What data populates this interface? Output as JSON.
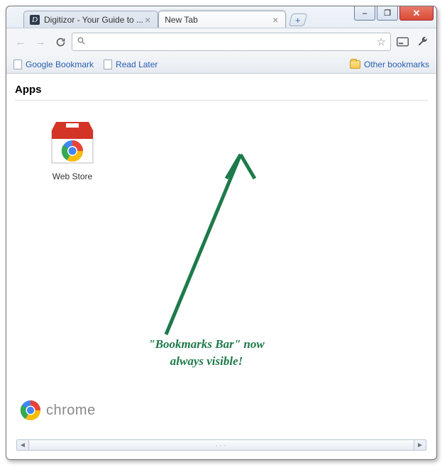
{
  "window_controls": {
    "minimize": "–",
    "maximize": "❐",
    "close": "✕"
  },
  "tabs": [
    {
      "title": "Digitizor - Your Guide to ..."
    },
    {
      "title": "New Tab"
    }
  ],
  "toolbar": {
    "back": "←",
    "forward": "→",
    "reload": "↻",
    "search_placeholder": "",
    "omnibox_value": "",
    "star": "☆",
    "page_action": "▭",
    "wrench": ""
  },
  "bookmarks_bar": {
    "items": [
      {
        "label": "Google Bookmark"
      },
      {
        "label": "Read Later"
      }
    ],
    "other_label": "Other bookmarks"
  },
  "content": {
    "section_title": "Apps",
    "apps": [
      {
        "label": "Web Store"
      }
    ],
    "brand": "chrome"
  },
  "annotation": {
    "line1": "\"Bookmarks Bar\" now",
    "line2": "always visible!"
  }
}
